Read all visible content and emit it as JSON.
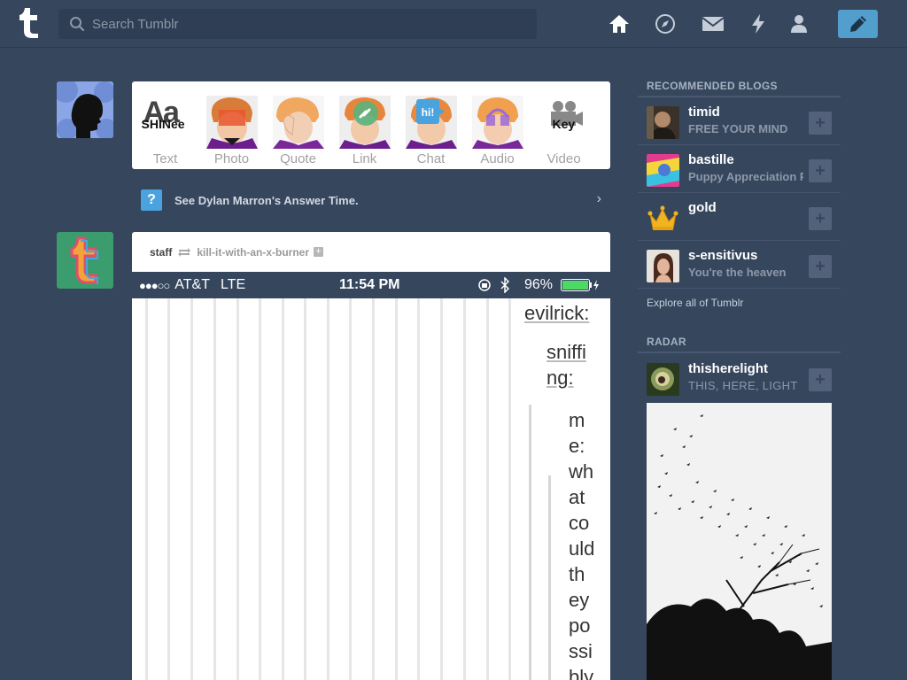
{
  "header": {
    "search_placeholder": "Search Tumblr",
    "logo_letter": "t",
    "nav": [
      "home-icon",
      "explore-icon",
      "inbox-icon",
      "activity-icon",
      "account-icon"
    ],
    "compose_icon": "pencil-icon"
  },
  "post_types": [
    {
      "label": "Text",
      "art": "Aa"
    },
    {
      "label": "Photo"
    },
    {
      "label": "Quote"
    },
    {
      "label": "Link"
    },
    {
      "label": "Chat",
      "art": "hi!"
    },
    {
      "label": "Audio"
    },
    {
      "label": "Video"
    }
  ],
  "post_type_text_overlay": "SHINee",
  "post_type_video_overlay": "Key",
  "answer_bar": {
    "icon": "?",
    "text": "See Dylan Marron's Answer Time.",
    "arrow": "›"
  },
  "post": {
    "author": "staff",
    "reblogged_from": "kill-it-with-an-x-burner",
    "plus": "+",
    "status_bar": {
      "signal": "●●●○○",
      "carrier": "AT&T",
      "network": "LTE",
      "time": "11:54 PM",
      "battery": "96%"
    },
    "thread": {
      "user1": "evilrick:",
      "user2": [
        "sniffi",
        "ng:"
      ],
      "reply": [
        "m",
        "e:",
        "wh",
        "at",
        "co",
        "uld",
        "th",
        "ey",
        "po",
        "ssi",
        "bly"
      ]
    }
  },
  "sidebar": {
    "recommended_title": "RECOMMENDED BLOGS",
    "blogs": [
      {
        "name": "timid",
        "desc": "FREE YOUR MIND"
      },
      {
        "name": "bastille",
        "desc": "Puppy Appreciation Post"
      },
      {
        "name": "gold",
        "desc": ""
      },
      {
        "name": "s-ensitivus",
        "desc": "You're the heaven"
      }
    ],
    "explore_link": "Explore all of Tumblr",
    "radar_title": "RADAR",
    "radar_blog": {
      "name": "thisherelight",
      "desc": "THIS, HERE, LIGHT"
    },
    "follow_symbol": "+"
  },
  "colors": {
    "background": "#36465d",
    "accent": "#529ecc",
    "battery": "#4cd964"
  }
}
